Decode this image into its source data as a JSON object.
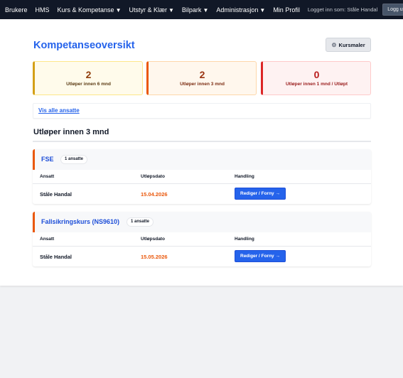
{
  "navbar": {
    "items": [
      {
        "label": "Brukere",
        "caret": ""
      },
      {
        "label": "HMS",
        "caret": ""
      },
      {
        "label": "Kurs & Kompetanse",
        "caret": "▼"
      },
      {
        "label": "Utstyr & Klær",
        "caret": "▼"
      },
      {
        "label": "Bilpark",
        "caret": "▼"
      },
      {
        "label": "Administrasjon",
        "caret": "▼"
      },
      {
        "label": "Min Profil",
        "caret": ""
      }
    ],
    "logged_in_text": "Logget inn som: Ståle Handal",
    "logout_label": "Logg ut"
  },
  "page": {
    "title": "Kompetanseoversikt",
    "kursmaler_label": "Kursmaler"
  },
  "stats": [
    {
      "count": "2",
      "label": "Utløper innen 6 mnd"
    },
    {
      "count": "2",
      "label": "Utløper innen 3 mnd"
    },
    {
      "count": "0",
      "label": "Utløper innen 1 mnd / Utløpt"
    }
  ],
  "show_all_label": "Vis alle ansatte",
  "section": {
    "title": "Utløper innen 3 mnd"
  },
  "columns": {
    "employee": "Ansatt",
    "expiry": "Utløpsdato",
    "action": "Handling"
  },
  "courses": [
    {
      "name": "FSE",
      "count_label": "1 ansatte",
      "rows": [
        {
          "employee": "Ståle Handal",
          "expiry": "15.04.2026",
          "action_label": "Rediger / Forny →"
        }
      ]
    },
    {
      "name": "Fallsikringskurs (NS9610)",
      "count_label": "1 ansatte",
      "rows": [
        {
          "employee": "Ståle Handal",
          "expiry": "15.05.2026",
          "action_label": "Rediger / Forny →"
        }
      ]
    }
  ],
  "colors": {
    "accent_blue": "#2563eb",
    "navbar_bg": "#111827",
    "warning_orange": "#ea580c",
    "warning_yellow": "#d4a017",
    "danger_red": "#dc2626"
  },
  "icons": {
    "kursmaler": "gear-icon"
  }
}
